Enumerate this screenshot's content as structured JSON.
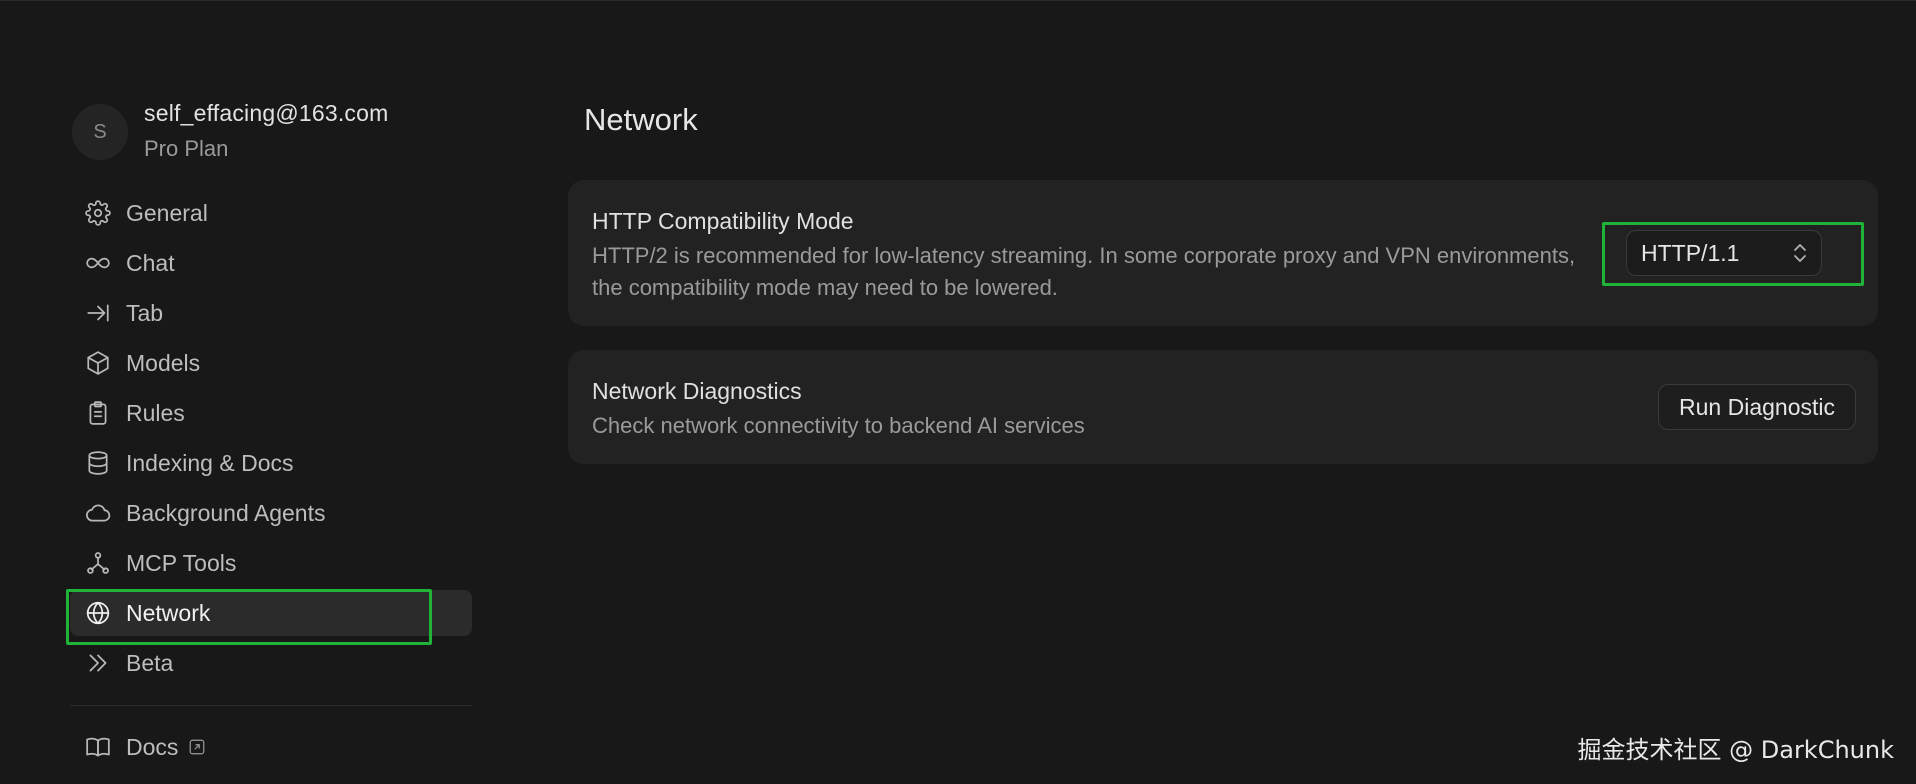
{
  "profile": {
    "avatar_letter": "S",
    "email": "self_effacing@163.com",
    "plan": "Pro Plan"
  },
  "sidebar": {
    "items": [
      {
        "label": "General",
        "icon": "gear-icon"
      },
      {
        "label": "Chat",
        "icon": "infinity-icon"
      },
      {
        "label": "Tab",
        "icon": "arrow-to-line-icon"
      },
      {
        "label": "Models",
        "icon": "cube-icon"
      },
      {
        "label": "Rules",
        "icon": "clipboard-icon"
      },
      {
        "label": "Indexing & Docs",
        "icon": "database-icon"
      },
      {
        "label": "Background Agents",
        "icon": "cloud-icon"
      },
      {
        "label": "MCP Tools",
        "icon": "nodes-icon"
      },
      {
        "label": "Network",
        "icon": "globe-icon",
        "active": true
      },
      {
        "label": "Beta",
        "icon": "double-chevron-right-icon"
      }
    ],
    "docs_label": "Docs",
    "docs_icon": "book-icon",
    "docs_external_icon": "external-link-icon"
  },
  "main": {
    "title": "Network",
    "http_mode": {
      "title": "HTTP Compatibility Mode",
      "description": "HTTP/2 is recommended for low-latency streaming. In some corporate proxy and VPN environments, the compatibility mode may need to be lowered.",
      "selected_value": "HTTP/1.1"
    },
    "diagnostics": {
      "title": "Network Diagnostics",
      "description": "Check network connectivity to backend AI services",
      "button_label": "Run Diagnostic"
    }
  },
  "watermark": "掘金技术社区 @ DarkChunk",
  "colors": {
    "background": "#181818",
    "card": "#222222",
    "highlight": "#1fb33a",
    "active_nav": "#2b2b2b"
  }
}
